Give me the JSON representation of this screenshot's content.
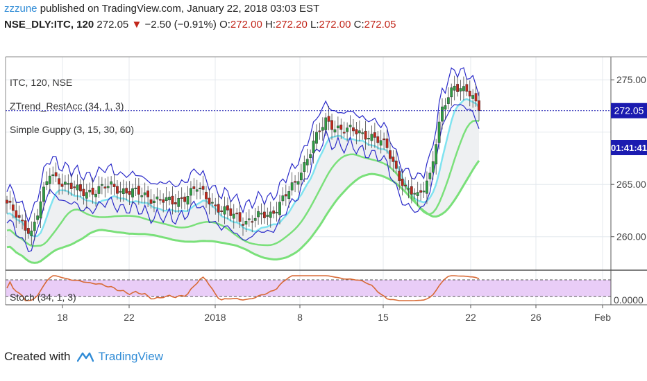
{
  "header": {
    "user": "zzzune",
    "published": "published on TradingView.com, January 22, 2018 03:03 EST"
  },
  "quote": {
    "symbol": "NSE_DLY:ITC, 120",
    "price": "272.05",
    "change": "−2.50 (−0.91%)",
    "o_label": "O:",
    "o": "272.00",
    "h_label": "H:",
    "h": "272.20",
    "l_label": "L:",
    "l": "272.00",
    "c_label": "C:",
    "c": "272.05"
  },
  "legend": {
    "line1": "ITC, 120, NSE",
    "line2": "ZTrend_RestAcc (34, 1, 3)",
    "line3": "Simple Guppy (3, 15, 30, 60)",
    "stoch": "Stoch (34, 1, 3)"
  },
  "price_badge": "272.05",
  "time_badge": "01:41:41",
  "stoch_axis_label": "0.0000",
  "footer": {
    "created": "Created with",
    "brand": "TradingView"
  },
  "colors": {
    "up": "#2ea043",
    "down": "#c2271b",
    "envelope": "#2a2ac9",
    "guppy_fast": "#7fe3f0",
    "guppy_slow": "#7ae07a",
    "stoch_line": "#d86a35",
    "stoch_band": "#e9cdf7",
    "price_line": "#1b1bb0"
  },
  "chart_data": {
    "type": "candlestick",
    "ylim": [
      257,
      277
    ],
    "y_ticks": [
      "275.00",
      "265.00",
      "260.00"
    ],
    "x_ticks": [
      "18",
      "22",
      "2018",
      "8",
      "15",
      "22",
      "26",
      "Feb"
    ],
    "last_price": 272.05,
    "anchors": [
      {
        "i": 0,
        "p": 263.2
      },
      {
        "i": 4,
        "p": 261.5
      },
      {
        "i": 8,
        "p": 260.5
      },
      {
        "i": 14,
        "p": 266.0
      },
      {
        "i": 24,
        "p": 264.2
      },
      {
        "i": 34,
        "p": 264.8
      },
      {
        "i": 44,
        "p": 264.0
      },
      {
        "i": 54,
        "p": 263.2
      },
      {
        "i": 62,
        "p": 264.6
      },
      {
        "i": 70,
        "p": 262.5
      },
      {
        "i": 78,
        "p": 261.5
      },
      {
        "i": 86,
        "p": 262.2
      },
      {
        "i": 94,
        "p": 265.0
      },
      {
        "i": 100,
        "p": 269.0
      },
      {
        "i": 104,
        "p": 271.0
      },
      {
        "i": 110,
        "p": 270.2
      },
      {
        "i": 118,
        "p": 269.8
      },
      {
        "i": 124,
        "p": 268.5
      },
      {
        "i": 130,
        "p": 264.5
      },
      {
        "i": 134,
        "p": 263.8
      },
      {
        "i": 138,
        "p": 266.0
      },
      {
        "i": 142,
        "p": 272.0
      },
      {
        "i": 146,
        "p": 274.6
      },
      {
        "i": 150,
        "p": 274.0
      },
      {
        "i": 154,
        "p": 272.05
      }
    ],
    "bars": 155,
    "guppy": [
      {
        "name": "",
        "offset": -1.0,
        "lag": 5
      },
      {
        "name": "",
        "offset": -2.6,
        "lag": 10
      },
      {
        "name": "",
        "offset": -4.2,
        "lag": 18
      }
    ]
  }
}
